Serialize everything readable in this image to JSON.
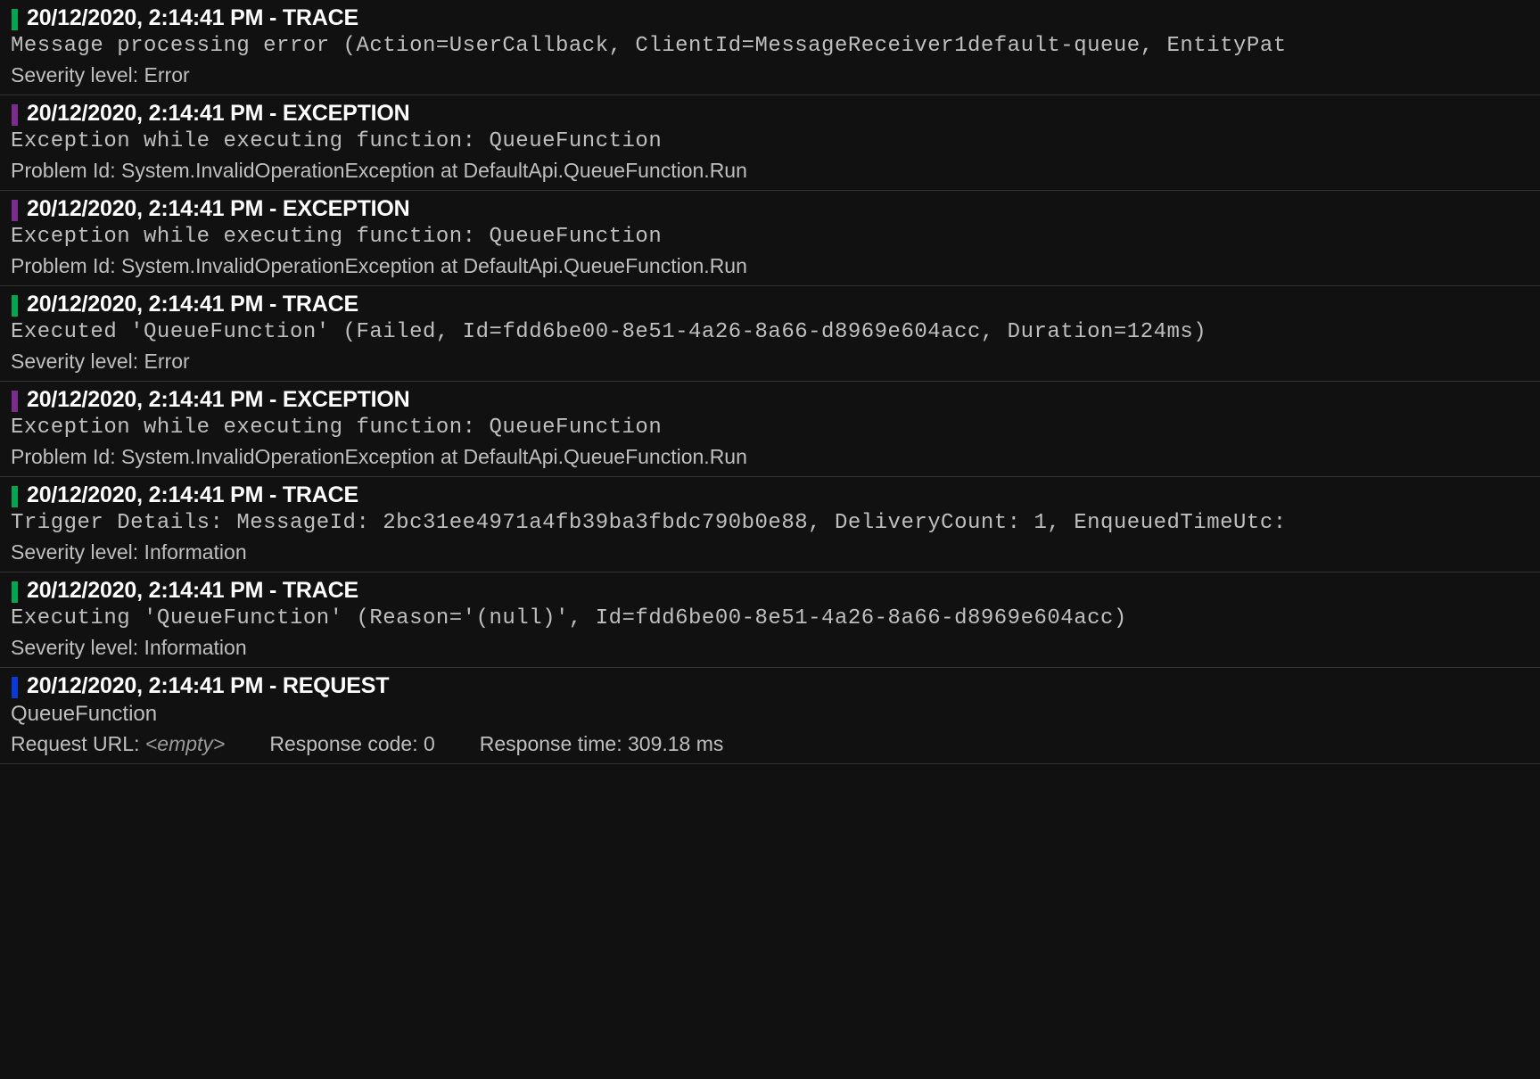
{
  "colors": {
    "trace": "#00a651",
    "exception": "#7b2d8e",
    "request": "#0b39d6"
  },
  "entries": [
    {
      "type": "TRACE",
      "timestamp": "20/12/2020, 2:14:41 PM",
      "bar": "green",
      "message": "Message processing error (Action=UserCallback, ClientId=MessageReceiver1default-queue, EntityPat",
      "meta": "Severity level: Error"
    },
    {
      "type": "EXCEPTION",
      "timestamp": "20/12/2020, 2:14:41 PM",
      "bar": "purple",
      "message": "Exception while executing function: QueueFunction",
      "meta": "Problem Id: System.InvalidOperationException at DefaultApi.QueueFunction.Run"
    },
    {
      "type": "EXCEPTION",
      "timestamp": "20/12/2020, 2:14:41 PM",
      "bar": "purple",
      "message": "Exception while executing function: QueueFunction",
      "meta": "Problem Id: System.InvalidOperationException at DefaultApi.QueueFunction.Run"
    },
    {
      "type": "TRACE",
      "timestamp": "20/12/2020, 2:14:41 PM",
      "bar": "green",
      "message": "Executed 'QueueFunction' (Failed, Id=fdd6be00-8e51-4a26-8a66-d8969e604acc, Duration=124ms)",
      "meta": "Severity level: Error"
    },
    {
      "type": "EXCEPTION",
      "timestamp": "20/12/2020, 2:14:41 PM",
      "bar": "purple",
      "message": "Exception while executing function: QueueFunction",
      "meta": "Problem Id: System.InvalidOperationException at DefaultApi.QueueFunction.Run"
    },
    {
      "type": "TRACE",
      "timestamp": "20/12/2020, 2:14:41 PM",
      "bar": "green",
      "message": "Trigger Details: MessageId: 2bc31ee4971a4fb39ba3fbdc790b0e88, DeliveryCount: 1, EnqueuedTimeUtc:",
      "meta": "Severity level: Information"
    },
    {
      "type": "TRACE",
      "timestamp": "20/12/2020, 2:14:41 PM",
      "bar": "green",
      "message": "Executing 'QueueFunction' (Reason='(null)', Id=fdd6be00-8e51-4a26-8a66-d8969e604acc)",
      "meta": "Severity level: Information"
    },
    {
      "type": "REQUEST",
      "timestamp": "20/12/2020, 2:14:41 PM",
      "bar": "blue",
      "plainMsg": "QueueFunction",
      "request": {
        "urlLabel": "Request URL:",
        "urlValue": "<empty>",
        "codeLabel": "Response code:",
        "codeValue": "0",
        "timeLabel": "Response time:",
        "timeValue": "309.18 ms"
      }
    }
  ]
}
